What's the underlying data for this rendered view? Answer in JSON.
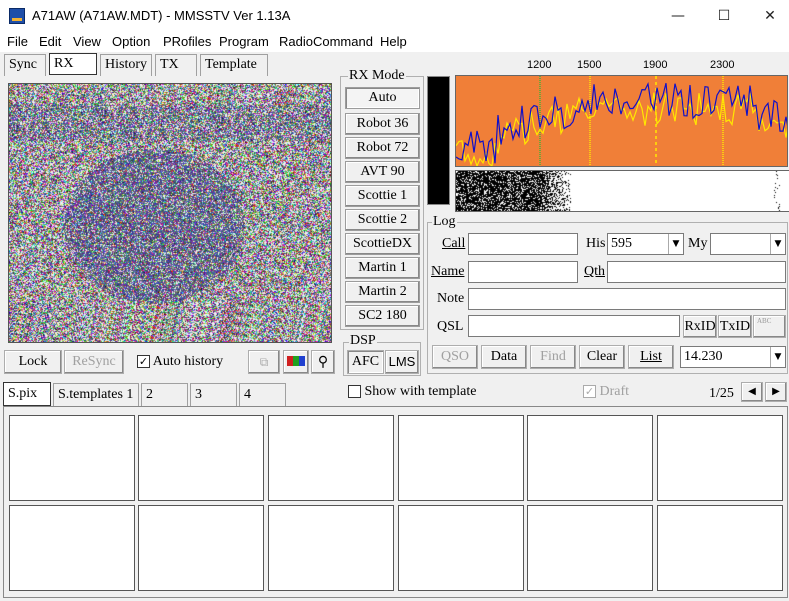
{
  "window": {
    "title": "A71AW (A71AW.MDT) - MMSSTV Ver 1.13A"
  },
  "menu": [
    "File",
    "Edit",
    "View",
    "Option",
    "PRofiles",
    "Program",
    "RadioCommand",
    "Help"
  ],
  "top_tabs": [
    "Sync",
    "RX",
    "History",
    "TX",
    "Template"
  ],
  "rx_mode": {
    "title": "RX Mode",
    "modes": [
      "Auto",
      "Robot 36",
      "Robot 72",
      "AVT 90",
      "Scottie 1",
      "Scottie 2",
      "ScottieDX",
      "Martin 1",
      "Martin 2",
      "SC2 180"
    ],
    "selected": "Auto"
  },
  "spectrum": {
    "ticks": [
      "1200",
      "1500",
      "1900",
      "2300"
    ],
    "colors": {
      "background": "#f07f38",
      "blue_trace": "#1010c8",
      "yellow_trace": "#ffe800",
      "green_marker": "#3cb43c"
    }
  },
  "rx_controls": {
    "lock": "Lock",
    "resync": "ReSync",
    "auto_history": "Auto history",
    "auto_history_checked": true
  },
  "dsp": {
    "title": "DSP",
    "afc": "AFC",
    "lms": "LMS"
  },
  "log": {
    "title": "Log",
    "call_label": "Call",
    "call_value": "",
    "his_label": "His",
    "his_value": "595",
    "my_label": "My",
    "my_value": "",
    "name_label": "Name",
    "name_value": "",
    "qth_label": "Qth",
    "qth_value": "",
    "note_label": "Note",
    "note_value": "",
    "qsl_label": "QSL",
    "qsl_value": "",
    "rxid": "RxID",
    "txid": "TxID",
    "abc_icon": "ABC",
    "buttons": {
      "qso": "QSO",
      "data": "Data",
      "find": "Find",
      "clear": "Clear",
      "list": "List"
    },
    "freq": "14.230"
  },
  "bottom_tabs": [
    "S.pix",
    "S.templates 1",
    "2",
    "3",
    "4"
  ],
  "show_with_template": "Show with template",
  "draft": "Draft",
  "page_indicator": "1/25"
}
